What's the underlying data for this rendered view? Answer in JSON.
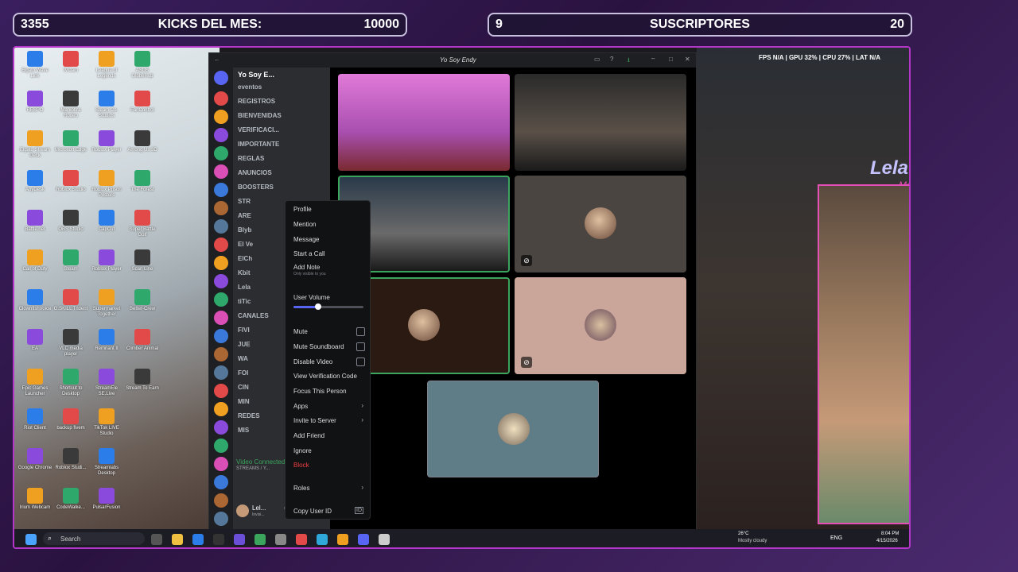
{
  "overlay": {
    "kicks": {
      "left": "3355",
      "center": "KICKS DEL MES:",
      "right": "10000"
    },
    "subs": {
      "left": "9",
      "center": "SUSCRIPTORES",
      "right": "20"
    },
    "stats": "FPS N/A | GPU 32% | CPU 27% | LAT N/A",
    "cam_name": "Lela",
    "cam_sub": "Meihan"
  },
  "desktop": {
    "icons": [
      "Elgato Wave Link",
      "IVCam",
      "League of Legends",
      "ASUS GlobeHub",
      "RESPO",
      "Maniobra Rodeo",
      "Steam Co. Studios",
      "FanControl",
      "Elgato Stream Deck",
      "Microsoft Edge",
      "Roblox Player",
      "Among Us 3D",
      "AnyDesk",
      "Roblox Studio",
      "Roblox Prison Posters",
      "The Forest",
      "Battle.net",
      "OBS Studio",
      "CapCut",
      "Super Battle Golf",
      "Call of Duty",
      "Steam",
      "Roblox Player",
      "Scan Line",
      "ClownfishVoice",
      "G.SKILL Trident",
      "Supermarket Together",
      "Better-Crew",
      "EA",
      "VLC media player",
      "Remnant II",
      "Climber Animal",
      "Epic Games Launcher",
      "Shortcut to Desktop",
      "StreamEle SE.Live",
      "Stream To Earn",
      "Riot Client",
      "backup fivem",
      "TikTok LIVE Studio",
      "",
      "Google Chrome",
      "Roblox Studi...",
      "Streamlabs Desktop",
      "",
      "Irium Webcam",
      "CodeWalke...",
      "PulsarFusion",
      ""
    ]
  },
  "discord": {
    "window_title": "Yo Soy Endy",
    "server_name": "Yo Soy E...",
    "channels": [
      "eventos",
      "REGISTROS",
      "BIENVENIDAS",
      "VERIFICACI...",
      "IMPORTANTE",
      "REGLAS",
      "ANUNCIOS",
      "BOOSTERS",
      "STR",
      "ARE",
      "Blyb",
      "El Ve",
      "ElCh",
      "Kbit",
      "Lela",
      "tiTic",
      "CANALES",
      "FIVI",
      "JUE",
      "WA",
      "FOI",
      "CIN",
      "MIN",
      "REDES",
      "MIS"
    ],
    "voice_status": "Video Connected",
    "voice_sub": "STREAMS / Y...",
    "user_name": "Lel...",
    "user_status": "Invisi..."
  },
  "context_menu": {
    "items": [
      "Profile",
      "Mention",
      "Message",
      "Start a Call",
      "Add Note"
    ],
    "note_hint": "Only visible to you",
    "volume_label": "User Volume",
    "volume_pct": 0.35,
    "toggles": [
      "Mute",
      "Mute Soundboard",
      "Disable Video"
    ],
    "more": [
      "View Verification Code",
      "Focus This Person"
    ],
    "sub": [
      "Apps",
      "Invite to Server"
    ],
    "add_friend": "Add Friend",
    "ignore": "Ignore",
    "block": "Block",
    "roles": "Roles",
    "copy_id": "Copy User ID"
  },
  "taskbar": {
    "search": "Search",
    "weather_temp": "26°C",
    "weather_desc": "Mostly cloudy",
    "lang": "ENG",
    "time": "8:04 PM",
    "date": "4/15/2026"
  },
  "colors": {
    "accent": "#b537c9",
    "cam_border": "#e64fb5",
    "block": "#f23f43"
  }
}
